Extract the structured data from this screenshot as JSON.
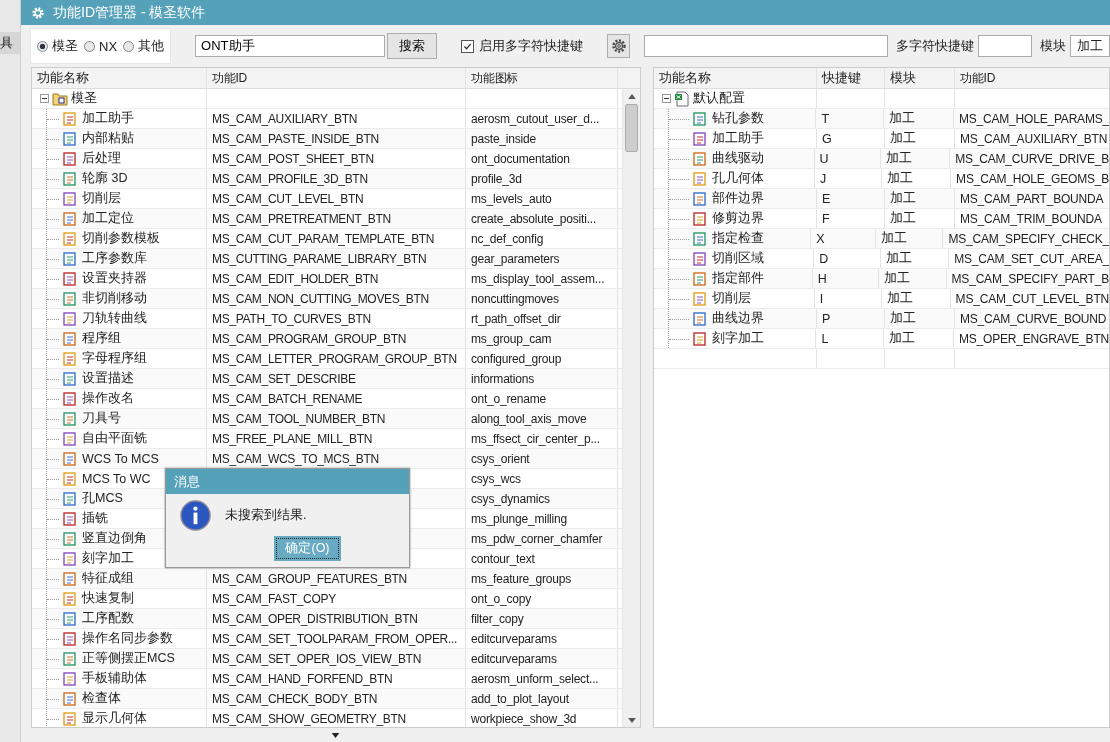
{
  "background_app": {
    "label": "具"
  },
  "window": {
    "title": "功能ID管理器 - 模圣软件"
  },
  "source_options": [
    {
      "label": "模圣",
      "selected": true
    },
    {
      "label": "NX",
      "selected": false
    },
    {
      "label": "其他",
      "selected": false
    }
  ],
  "search": {
    "value": "ONT助手",
    "button": "搜索"
  },
  "multi_char_option": {
    "label": "启用多字符快捷键",
    "checked": true
  },
  "right_toolbar": {
    "shortcut_label": "多字符快捷键",
    "module_label": "模块",
    "module_value": "加工"
  },
  "function_table": {
    "columns": [
      "功能名称",
      "功能ID",
      "功能图标"
    ],
    "root": {
      "name": "模圣",
      "expanded": true
    },
    "rows": [
      {
        "name": "加工助手",
        "id": "MS_CAM_AUXILIARY_BTN",
        "icon": "aerosm_cutout_user_d..."
      },
      {
        "name": "内部粘贴",
        "id": "MS_CAM_PASTE_INSIDE_BTN",
        "icon": "paste_inside"
      },
      {
        "name": "后处理",
        "id": "MS_CAM_POST_SHEET_BTN",
        "icon": "ont_documentation"
      },
      {
        "name": "轮廓 3D",
        "id": "MS_CAM_PROFILE_3D_BTN",
        "icon": "profile_3d"
      },
      {
        "name": "切削层",
        "id": "MS_CAM_CUT_LEVEL_BTN",
        "icon": "ms_levels_auto"
      },
      {
        "name": "加工定位",
        "id": "MS_CAM_PRETREATMENT_BTN",
        "icon": "create_absolute_positi..."
      },
      {
        "name": "切削参数模板",
        "id": "MS_CAM_CUT_PARAM_TEMPLATE_BTN",
        "icon": "nc_def_config"
      },
      {
        "name": "工序参数库",
        "id": "MS_CUTTING_PARAME_LIBRARY_BTN",
        "icon": "gear_parameters"
      },
      {
        "name": "设置夹持器",
        "id": "MS_CAM_EDIT_HOLDER_BTN",
        "icon": "ms_display_tool_assem..."
      },
      {
        "name": "非切削移动",
        "id": "MS_CAM_NON_CUTTING_MOVES_BTN",
        "icon": "noncuttingmoves"
      },
      {
        "name": "刀轨转曲线",
        "id": "MS_PATH_TO_CURVES_BTN",
        "icon": "rt_path_offset_dir"
      },
      {
        "name": "程序组",
        "id": "MS_CAM_PROGRAM_GROUP_BTN",
        "icon": "ms_group_cam"
      },
      {
        "name": "字母程序组",
        "id": "MS_CAM_LETTER_PROGRAM_GROUP_BTN",
        "icon": "configured_group"
      },
      {
        "name": "设置描述",
        "id": "MS_CAM_SET_DESCRIBE",
        "icon": "informations"
      },
      {
        "name": "操作改名",
        "id": "MS_CAM_BATCH_RENAME",
        "icon": "ont_o_rename"
      },
      {
        "name": "刀具号",
        "id": "MS_CAM_TOOL_NUMBER_BTN",
        "icon": "along_tool_axis_move"
      },
      {
        "name": "自由平面铣",
        "id": "MS_FREE_PLANE_MILL_BTN",
        "icon": "ms_ffsect_cir_center_p..."
      },
      {
        "name": "WCS To MCS",
        "id": "MS_CAM_WCS_TO_MCS_BTN",
        "icon": "csys_orient"
      },
      {
        "name": "MCS To WC",
        "icon": "csys_wcs"
      },
      {
        "name": "孔MCS",
        "icon": "csys_dynamics"
      },
      {
        "name": "插铣",
        "icon": "ms_plunge_milling"
      },
      {
        "name": "竖直边倒角",
        "icon": "ms_pdw_corner_chamfer"
      },
      {
        "name": "刻字加工",
        "icon": "contour_text"
      },
      {
        "name": "特征成组",
        "id": "MS_CAM_GROUP_FEATURES_BTN",
        "icon": "ms_feature_groups"
      },
      {
        "name": "快速复制",
        "id": "MS_CAM_FAST_COPY",
        "icon": "ont_o_copy"
      },
      {
        "name": "工序配数",
        "id": "MS_CAM_OPER_DISTRIBUTION_BTN",
        "icon": "filter_copy"
      },
      {
        "name": "操作名同步参数",
        "id": "MS_CAM_SET_TOOLPARAM_FROM_OPER...",
        "icon": "editcurveparams"
      },
      {
        "name": "正等侧摆正MCS",
        "id": "MS_CAM_SET_OPER_IOS_VIEW_BTN",
        "icon": "editcurveparams"
      },
      {
        "name": "手板辅助体",
        "id": "MS_CAM_HAND_FORFEND_BTN",
        "icon": "aerosm_unform_select..."
      },
      {
        "name": "检查体",
        "id": "MS_CAM_CHECK_BODY_BTN",
        "icon": "add_to_plot_layout"
      },
      {
        "name": "显示几何体",
        "id": "MS_CAM_SHOW_GEOMETRY_BTN",
        "icon": "workpiece_show_3d"
      }
    ]
  },
  "shortcut_table": {
    "columns": [
      "功能名称",
      "快捷键",
      "模块",
      "功能ID"
    ],
    "root": {
      "name": "默认配置",
      "expanded": true
    },
    "rows": [
      {
        "name": "钻孔参数",
        "key": "T",
        "module": "加工",
        "id": "MS_CAM_HOLE_PARAMS_"
      },
      {
        "name": "加工助手",
        "key": "G",
        "module": "加工",
        "id": "MS_CAM_AUXILIARY_BTN"
      },
      {
        "name": "曲线驱动",
        "key": "U",
        "module": "加工",
        "id": "MS_CAM_CURVE_DRIVE_B"
      },
      {
        "name": "孔几何体",
        "key": "J",
        "module": "加工",
        "id": "MS_CAM_HOLE_GEOMS_B"
      },
      {
        "name": "部件边界",
        "key": "E",
        "module": "加工",
        "id": "MS_CAM_PART_BOUNDA"
      },
      {
        "name": "修剪边界",
        "key": "F",
        "module": "加工",
        "id": "MS_CAM_TRIM_BOUNDA"
      },
      {
        "name": "指定检查",
        "key": "X",
        "module": "加工",
        "id": "MS_CAM_SPECIFY_CHECK_"
      },
      {
        "name": "切削区域",
        "key": "D",
        "module": "加工",
        "id": "MS_CAM_SET_CUT_AREA_"
      },
      {
        "name": "指定部件",
        "key": "H",
        "module": "加工",
        "id": "MS_CAM_SPECIFY_PART_B"
      },
      {
        "name": "切削层",
        "key": "I",
        "module": "加工",
        "id": "MS_CAM_CUT_LEVEL_BTN"
      },
      {
        "name": "曲线边界",
        "key": "P",
        "module": "加工",
        "id": "MS_CAM_CURVE_BOUND"
      },
      {
        "name": "刻字加工",
        "key": "L",
        "module": "加工",
        "id": "MS_OPER_ENGRAVE_BTN"
      }
    ]
  },
  "dialog": {
    "title": "消息",
    "message": "未搜索到结果.",
    "button": "确定(O)"
  }
}
